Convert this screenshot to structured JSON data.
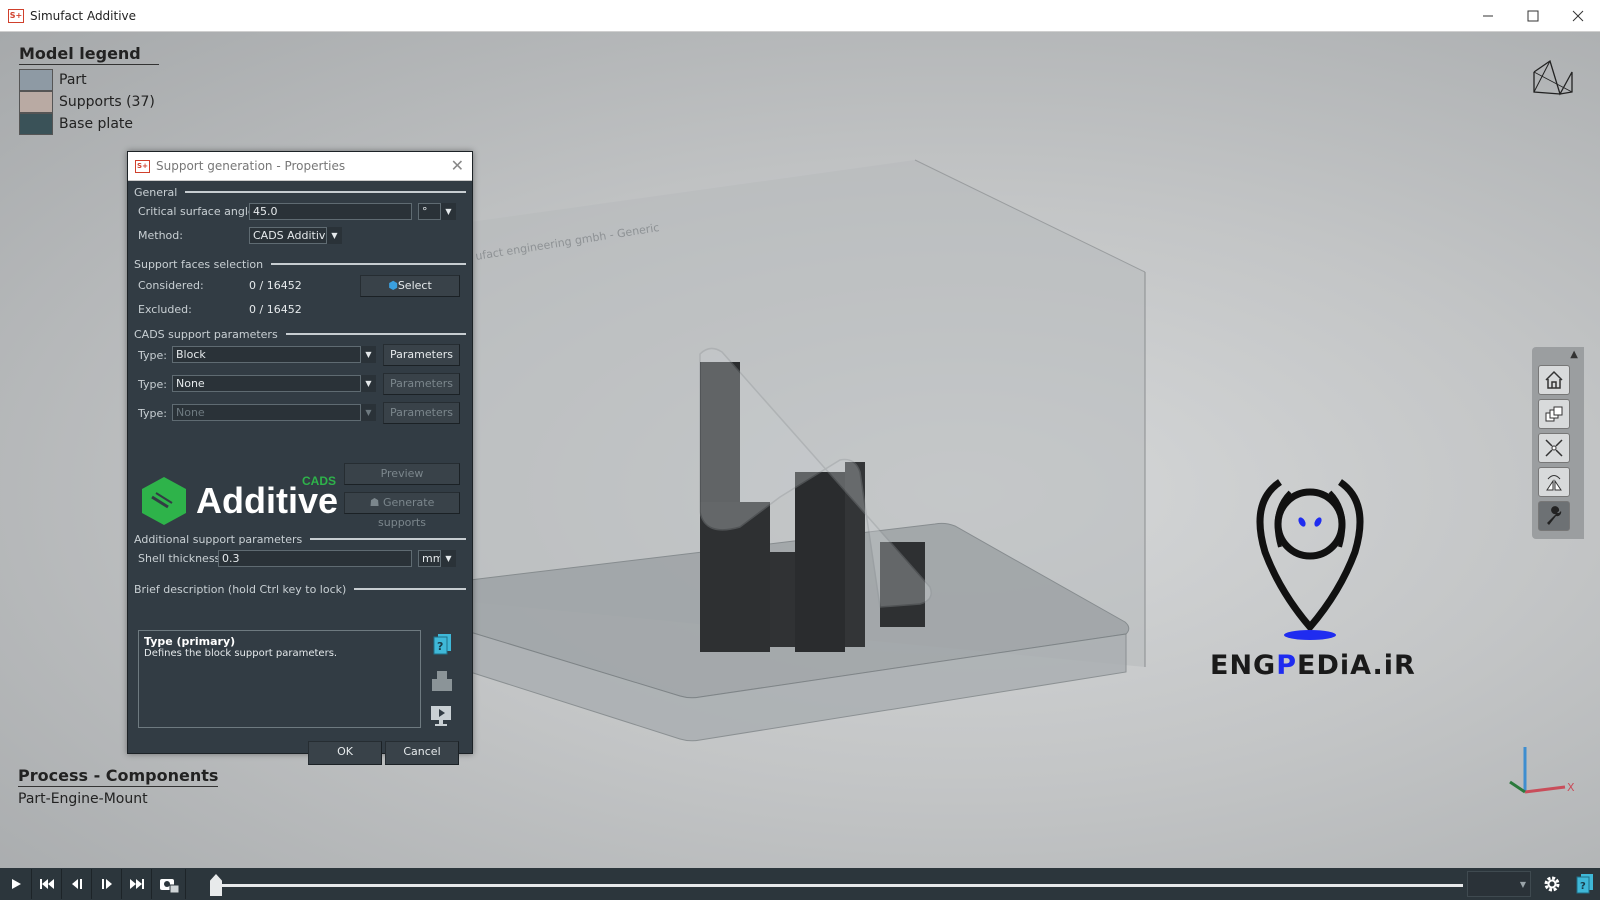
{
  "window": {
    "title": "Simufact Additive",
    "icon": "simufact-app-icon",
    "controls": [
      "minimize",
      "maximize",
      "close"
    ]
  },
  "legend": {
    "title": "Model legend",
    "items": [
      {
        "label": "Part",
        "color": "#8e9aa4"
      },
      {
        "label": "Supports (37)",
        "color": "#b9aaa3"
      },
      {
        "label": "Base plate",
        "color": "#3a5258"
      }
    ]
  },
  "process": {
    "title": "Process - Components",
    "component": "Part-Engine-Mount"
  },
  "scene": {
    "build_plate_label": "ufact engineering gmbh - Generic"
  },
  "watermark": {
    "text_a": "ENG",
    "text_b": "P",
    "text_c": "EDiA.iR"
  },
  "dialog": {
    "title": "Support generation - Properties",
    "sections": {
      "general": "General",
      "faces": "Support faces selection",
      "cads": "CADS support parameters",
      "additional": "Additional support parameters",
      "brief": "Brief description (hold Ctrl key to lock)"
    },
    "general": {
      "angle_label": "Critical surface angle:",
      "angle_value": "45.0",
      "angle_unit": "°",
      "method_label": "Method:",
      "method_value": "CADS Additive"
    },
    "faces": {
      "considered_label": "Considered:",
      "considered_value": "0 / 16452",
      "excluded_label": "Excluded:",
      "excluded_value": "0 / 16452",
      "select_button": "Select"
    },
    "cads": {
      "type_label": "Type:",
      "rows": [
        {
          "value": "Block",
          "button": "Parameters",
          "enabled": true
        },
        {
          "value": "None",
          "button": "Parameters",
          "enabled": false
        },
        {
          "value": "None",
          "button": "Parameters",
          "enabled": false
        }
      ]
    },
    "logo": {
      "text": "Additive",
      "badge": "CADS"
    },
    "preview_button": "Preview",
    "generate_button": "Generate supports",
    "additional": {
      "shell_label": "Shell thickness:",
      "shell_value": "0.3",
      "shell_unit": "mm"
    },
    "brief": {
      "title": "Type (primary)",
      "text": "Defines the block support parameters."
    },
    "ok_button": "OK",
    "cancel_button": "Cancel"
  },
  "view_toolbar": [
    "home-view",
    "rotate-view",
    "fit-view",
    "mirror-view",
    "tools"
  ],
  "bottom_bar": {
    "controls": [
      "play",
      "first",
      "step-back",
      "step-forward",
      "last",
      "screenshot"
    ],
    "timeline_position": 0,
    "select_value": ""
  }
}
